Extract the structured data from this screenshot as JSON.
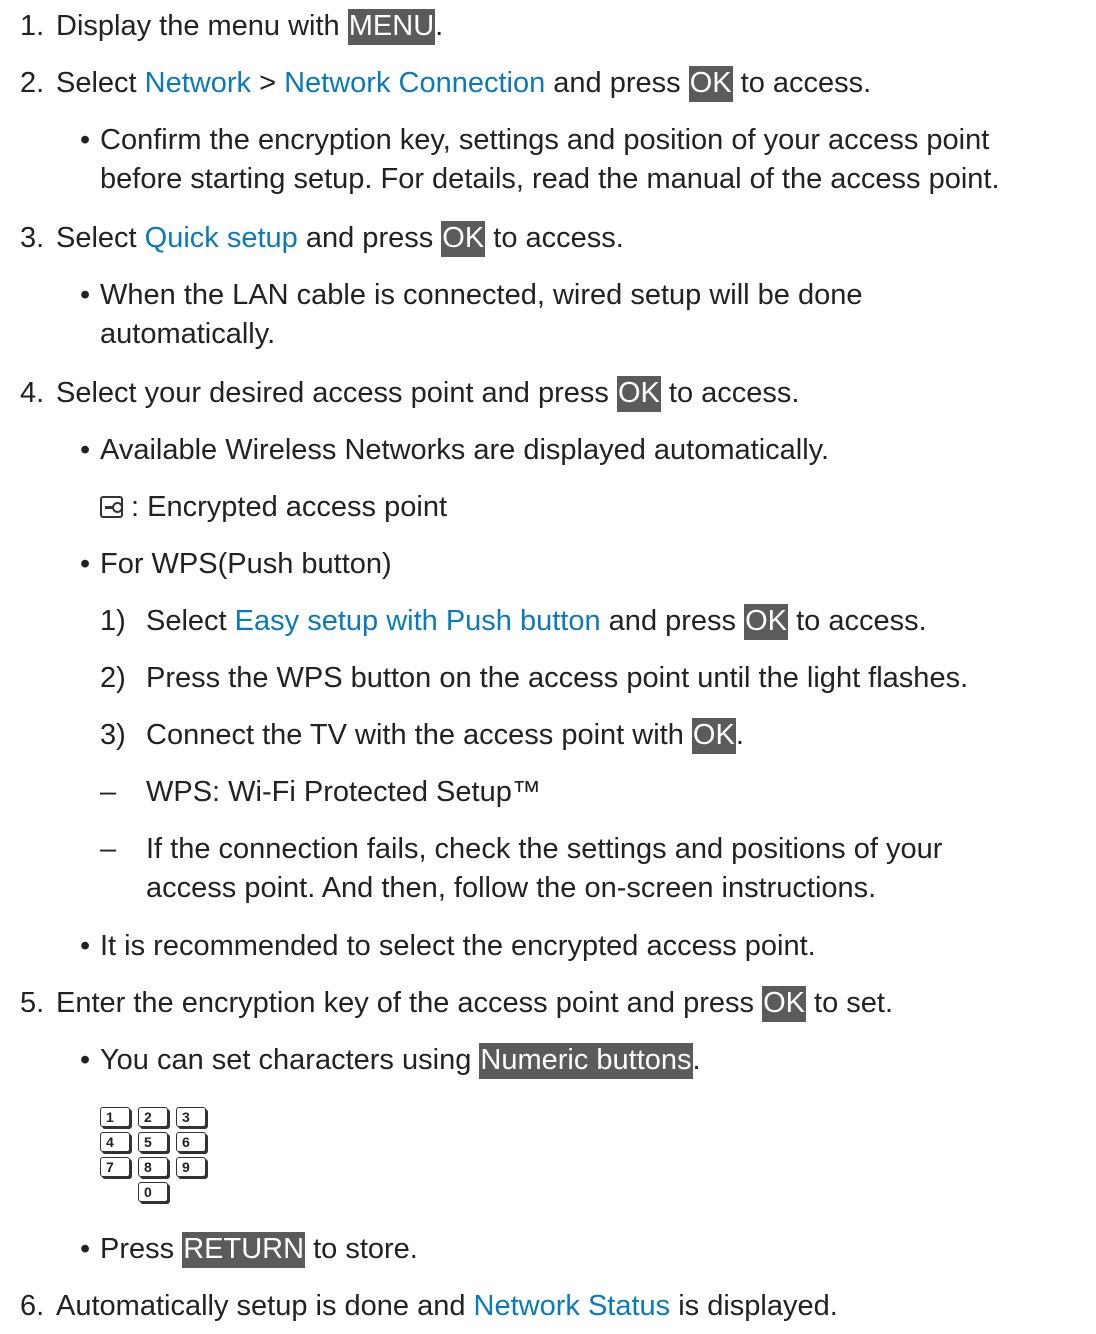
{
  "steps": {
    "s1": {
      "num": "1.",
      "pre": "Display the menu with ",
      "btn": "MENU",
      "post": "."
    },
    "s2": {
      "num": "2.",
      "pre": "Select ",
      "link1": "Network",
      "sep": " > ",
      "link2": "Network Connection",
      "mid": " and press ",
      "btn": "OK",
      "post": " to access."
    },
    "s2b": {
      "line1": "Confirm the encryption key, settings and position of your access point",
      "line2": "before starting setup. For details, read the manual of the access point."
    },
    "s3": {
      "num": "3.",
      "pre": "Select ",
      "link": "Quick setup",
      "mid": " and press ",
      "btn": "OK",
      "post": " to access."
    },
    "s3b": {
      "line1": "When the LAN cable is connected, wired setup will be done",
      "line2": "automatically."
    },
    "s4": {
      "num": "4.",
      "pre": "Select your desired access point and press ",
      "btn": "OK",
      "post": " to access."
    },
    "s4b1": {
      "text": "Available Wireless Networks are displayed automatically."
    },
    "s4icon": {
      "icon": "encrypted-access-point-icon",
      "text": " : Encrypted access point"
    },
    "s4b2": {
      "text": "For WPS(Push button)"
    },
    "sub1": {
      "num": "1)",
      "pre": "Select ",
      "link": "Easy setup with Push button",
      "mid": " and press ",
      "btn": "OK",
      "post": " to access."
    },
    "sub2": {
      "num": "2)",
      "text": "Press the WPS button on the access point until the light flashes."
    },
    "sub3": {
      "num": "3)",
      "pre": "Connect the TV with the access point with ",
      "btn": "OK",
      "post": "."
    },
    "note1": {
      "dash": "–",
      "text": "WPS: Wi-Fi Protected Setup™"
    },
    "note2": {
      "dash": "–",
      "line1": "If the connection fails, check the settings and positions of your",
      "line2": "access point. And then, follow the on-screen instructions."
    },
    "s4b3": {
      "text": "It is recommended to select the encrypted access point."
    },
    "s5": {
      "num": "5.",
      "pre": "Enter the encryption key of the access point and press ",
      "btn": "OK",
      "post": " to set."
    },
    "s5b1": {
      "pre": "You can set characters using ",
      "btn": "Numeric buttons",
      "post": "."
    },
    "keypad": [
      "1",
      "2",
      "3",
      "4",
      "5",
      "6",
      "7",
      "8",
      "9",
      "0"
    ],
    "s5b2": {
      "pre": "Press ",
      "btn": "RETURN",
      "post": " to store."
    },
    "s6": {
      "num": "6.",
      "pre": "Automatically setup is done and ",
      "link": "Network Status",
      "post": " is displayed."
    }
  },
  "colors": {
    "link": "#0a7abf",
    "button_bg": "#5b5b5b",
    "text": "#222222"
  }
}
